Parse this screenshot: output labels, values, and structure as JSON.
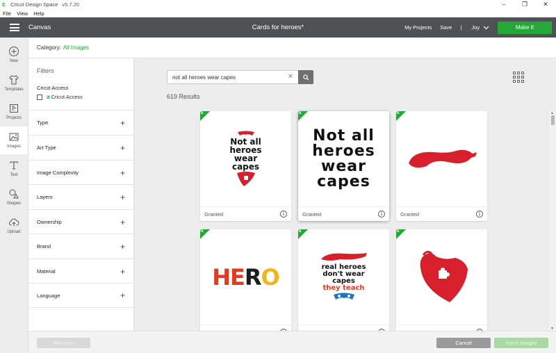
{
  "window": {
    "app_name": "Cricut Design Space",
    "version": "v5.7.20",
    "controls": [
      "–",
      "❐",
      "✕"
    ]
  },
  "menu": [
    "File",
    "View",
    "Help"
  ],
  "header": {
    "canvas_label": "Canvas",
    "project_title": "Cards for heroes*",
    "my_projects": "My Projects",
    "save": "Save",
    "separator": "|",
    "user": "Joy",
    "make_it": "Make It",
    "accent": "#25a838",
    "bar_color": "#4e5255"
  },
  "rail": [
    {
      "label": "New",
      "icon": "plus-circle-icon"
    },
    {
      "label": "Templates",
      "icon": "shirt-icon"
    },
    {
      "label": "Projects",
      "icon": "projects-icon"
    },
    {
      "label": "Images",
      "icon": "images-icon",
      "active": true
    },
    {
      "label": "Text",
      "icon": "text-icon"
    },
    {
      "label": "Shapes",
      "icon": "shapes-icon"
    },
    {
      "label": "Upload",
      "icon": "upload-cloud-icon"
    }
  ],
  "category": {
    "label": "Category:",
    "value": "All Images"
  },
  "filters": {
    "title": "Filters",
    "access_heading": "Cricut Access",
    "access_option": "Cricut Access",
    "rows": [
      "Type",
      "Art Type",
      "Image Complexity",
      "Layers",
      "Ownership",
      "Brand",
      "Material",
      "Language"
    ]
  },
  "search": {
    "value": "not all heroes wear capes",
    "placeholder": "Search images"
  },
  "results": "619 Results",
  "cards": [
    {
      "status": "Granted",
      "art": "not-all-heroes-small",
      "lines": [
        "Not all",
        "heroes",
        "wear",
        "capes"
      ]
    },
    {
      "status": "Granted",
      "art": "not-all-heroes-large",
      "lines": [
        "Not all",
        "heroes",
        "wear",
        "capes"
      ]
    },
    {
      "status": "Granted",
      "art": "red-cape-mask"
    },
    {
      "status": "",
      "art": "hero-word",
      "word": "HERO"
    },
    {
      "status": "",
      "art": "real-heroes-teach",
      "lines": [
        "real heroes",
        "don't wear",
        "capes",
        "they teach"
      ]
    },
    {
      "status": "",
      "art": "red-cape-puzzle"
    }
  ],
  "bottom": {
    "remove": "Remove",
    "cancel": "Cancel",
    "insert": "Insert Images"
  }
}
